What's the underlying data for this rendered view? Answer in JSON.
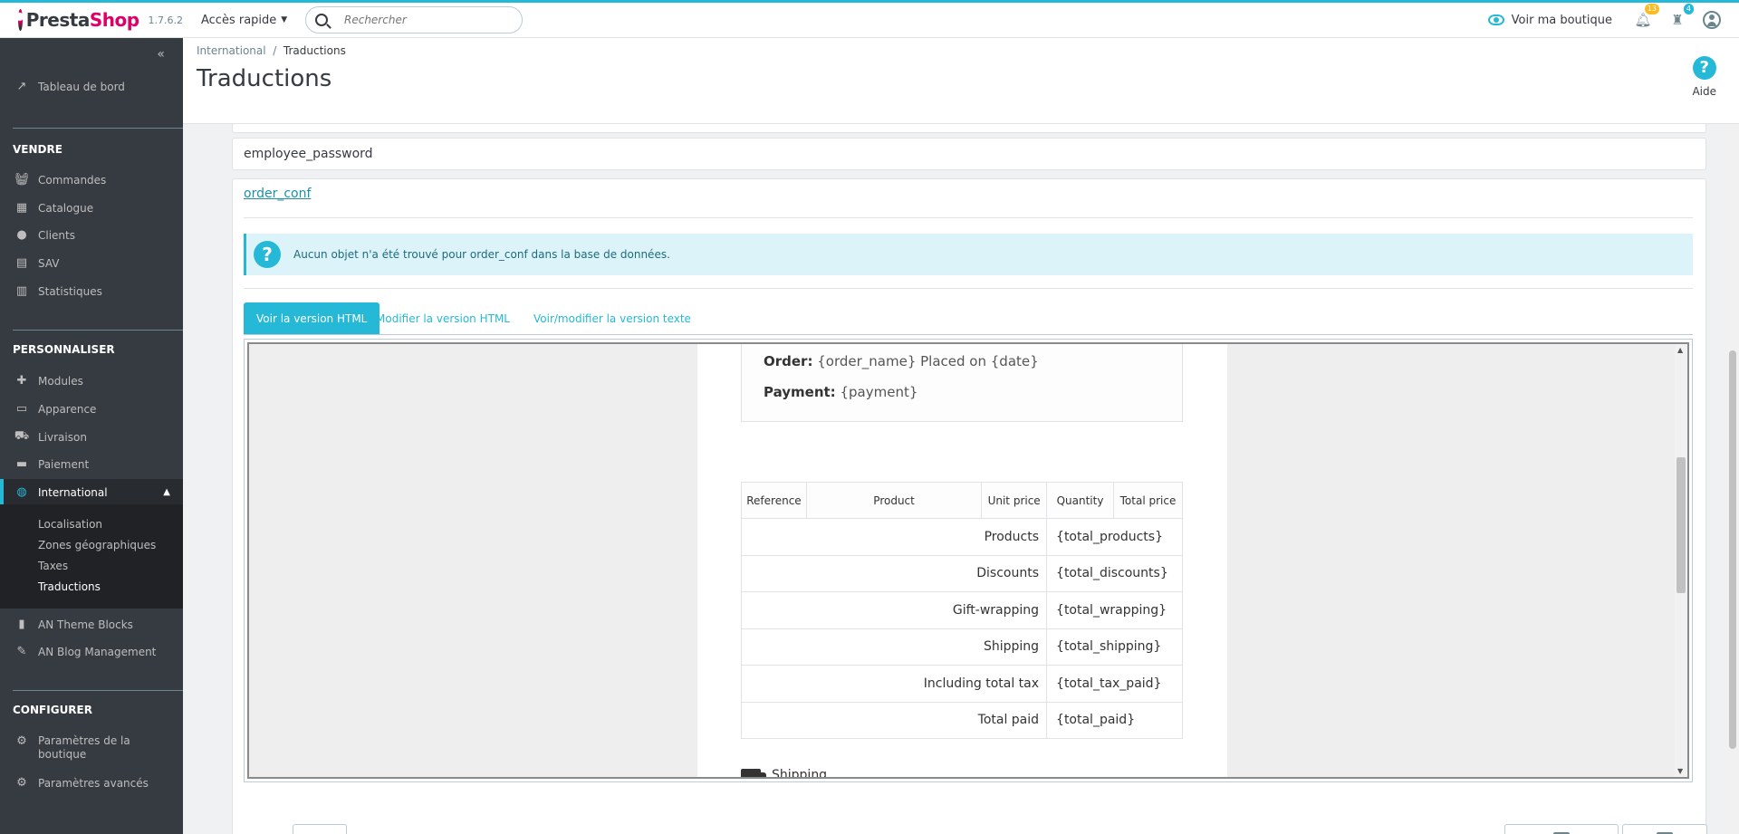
{
  "header": {
    "brand_presta": "Presta",
    "brand_shop": "Shop",
    "version": "1.7.6.2",
    "quick_access": "Accès rapide",
    "search_placeholder": "Rechercher",
    "view_shop": "Voir ma boutique",
    "notifications_orders": "13",
    "notifications_customers": "4"
  },
  "sidebar": {
    "dashboard": "Tableau de bord",
    "sections": {
      "sell": "VENDRE",
      "customize": "PERSONNALISER",
      "configure": "CONFIGURER"
    },
    "sell_items": [
      "Commandes",
      "Catalogue",
      "Clients",
      "SAV",
      "Statistiques"
    ],
    "customize_items": [
      "Modules",
      "Apparence",
      "Livraison",
      "Paiement",
      "International"
    ],
    "international_sub": [
      "Localisation",
      "Zones géographiques",
      "Taxes",
      "Traductions"
    ],
    "extra_items": [
      "AN Theme Blocks",
      "AN Blog Management"
    ],
    "configure_items": [
      "Paramètres de la boutique",
      "Paramètres avancés"
    ]
  },
  "pagehead": {
    "breadcrumb_parent": "International",
    "breadcrumb_sep": "/",
    "breadcrumb_current": "Traductions",
    "title": "Traductions",
    "help": "Aide"
  },
  "content": {
    "template_employee": "employee_password",
    "template_order": "order_conf",
    "alert": "Aucun objet n'a été trouvé pour order_conf dans la base de données.",
    "tabs": [
      "Voir la version HTML",
      "Modifier la version HTML",
      "Voir/modifier la version texte"
    ],
    "email": {
      "order_label": "Order:",
      "order_value": "{order_name} Placed on {date}",
      "payment_label": "Payment:",
      "payment_value": "{payment}",
      "table_headers": [
        "Reference",
        "Product",
        "Unit price",
        "Quantity",
        "Total price"
      ],
      "totals": [
        {
          "label": "Products",
          "value": "{total_products}"
        },
        {
          "label": "Discounts",
          "value": "{total_discounts}"
        },
        {
          "label": "Gift-wrapping",
          "value": "{total_wrapping}"
        },
        {
          "label": "Shipping",
          "value": "{total_shipping}"
        },
        {
          "label": "Including total tax",
          "value": "{total_tax_paid}"
        },
        {
          "label": "Total paid",
          "value": "{total_paid}"
        }
      ],
      "shipping_heading": "Shipping"
    }
  }
}
